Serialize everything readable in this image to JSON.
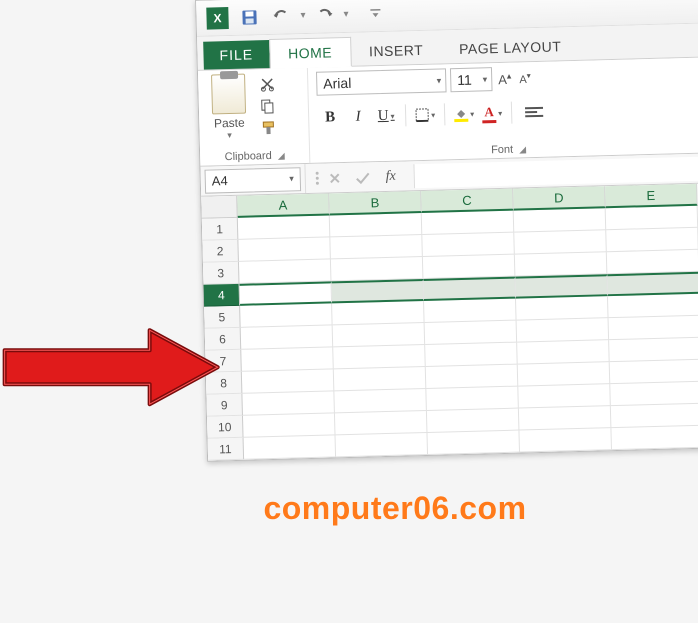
{
  "qat": {
    "items": [
      "excel-logo",
      "save",
      "undo",
      "redo",
      "customize"
    ]
  },
  "tabs": {
    "file": "FILE",
    "items": [
      {
        "label": "HOME",
        "active": true
      },
      {
        "label": "INSERT",
        "active": false
      },
      {
        "label": "PAGE LAYOUT",
        "active": false
      }
    ]
  },
  "ribbon": {
    "clipboard": {
      "paste_label": "Paste",
      "group_label": "Clipboard"
    },
    "font": {
      "font_name": "Arial",
      "font_size": "11",
      "bold": "B",
      "italic": "I",
      "underline": "U",
      "group_label": "Font"
    }
  },
  "formula_bar": {
    "name_box": "A4",
    "fx": "fx"
  },
  "grid": {
    "columns": [
      "A",
      "B",
      "C",
      "D",
      "E"
    ],
    "rows": [
      "1",
      "2",
      "3",
      "4",
      "5",
      "6",
      "7",
      "8",
      "9",
      "10",
      "11"
    ],
    "selected_row": "4",
    "active_cell": "A4"
  },
  "watermark": "computer06.com"
}
